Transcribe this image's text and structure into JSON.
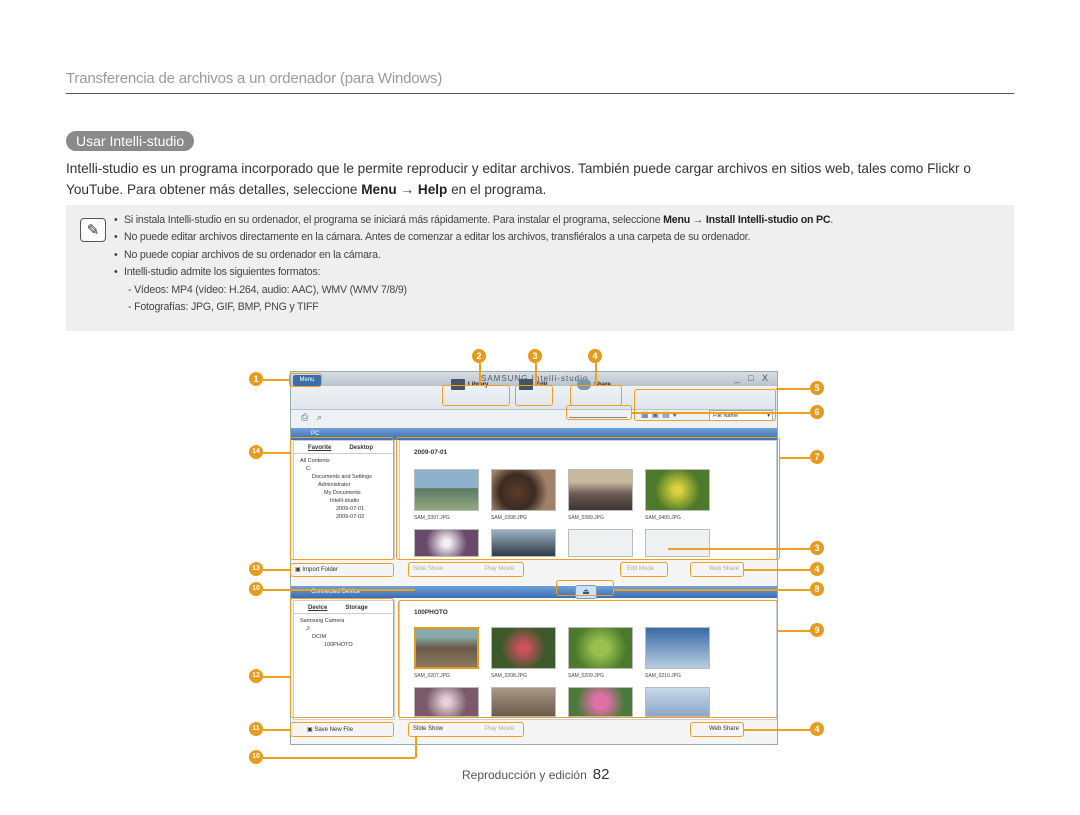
{
  "header": "Transferencia de archivos a un ordenador (para Windows)",
  "section_pill": "Usar Intelli-studio",
  "intro": {
    "text_1": "Intelli-studio es un programa incorporado que le permite reproducir y editar archivos. También puede cargar archivos en sitios web, tales como Flickr o YouTube. Para obtener más detalles, seleccione ",
    "menu": "Menu",
    "arrow": " → ",
    "help": "Help",
    "text_2": " en el programa."
  },
  "note": {
    "icon": "note-pencil-icon",
    "item1_a": "Si instala Intelli-studio en su ordenador, el programa se iniciará más rápidamente. Para instalar el programa, seleccione ",
    "item1_menu": "Menu",
    "item1_arrow": " → ",
    "item1_b": "Install Intelli-studio on PC",
    "item1_end": ".",
    "item2": "No puede editar archivos directamente en la cámara. Antes de comenzar a editar los archivos, transfiéralos a una carpeta de su ordenador.",
    "item3": "No puede copiar archivos de su ordenador en la cámara.",
    "item4": "Intelli-studio admite los siguientes formatos:",
    "sub1": "- Vídeos: MP4 (vídeo: H.264, audio: AAC), WMV (WMV 7/8/9)",
    "sub2": "- Fotografías: JPG, GIF, BMP, PNG y TIFF"
  },
  "app": {
    "brand": "SAMSUNG Intelli-studio",
    "menu": "Menu",
    "window_controls": "_ □ X",
    "library": "Library",
    "edit": "Edit",
    "share": "Share",
    "sort": "File Name",
    "pc_label": "PC",
    "tab_favorite": "Favorite",
    "tab_desktop": "Desktop",
    "pc_tree": [
      "All Contents",
      "C:",
      "Documents and Settings",
      "Administrator",
      "My Documents",
      "Intelli-studio",
      "2009-07-01",
      "2009-07-02"
    ],
    "pc_folder": "2009-07-01",
    "pc_files": [
      "SAM_0397.JPG",
      "SAM_0398.JPG",
      "SAM_0399.JPG",
      "SAM_0400.JPG"
    ],
    "import_folder": "Import Folder",
    "slide_show": "Slide Show",
    "play_movie": "Play Movie",
    "edit_mode": "Edit Mode",
    "web_share": "Web Share",
    "device_label": "Connected Device",
    "tab_device": "Device",
    "tab_storage": "Storage",
    "dev_tree": [
      "Samsung Camera",
      "J:",
      "DCIM",
      "100PHOTO"
    ],
    "dev_folder": "100PHOTO",
    "dev_files": [
      "SAM_0207.JPG",
      "SAM_0208.JPG",
      "SAM_0209.JPG",
      "SAM_0210.JPG"
    ],
    "save_new_file": "Save New File"
  },
  "callouts": [
    "1",
    "2",
    "3",
    "4",
    "5",
    "6",
    "7",
    "3",
    "4",
    "8",
    "9",
    "4",
    "10",
    "10",
    "11",
    "12",
    "13",
    "14"
  ],
  "footer": {
    "section": "Reproducción y edición",
    "page": "82"
  },
  "colors": {
    "callout": "#e79a1b",
    "note_bg": "#efefef",
    "pill": "#8a8a8a"
  }
}
